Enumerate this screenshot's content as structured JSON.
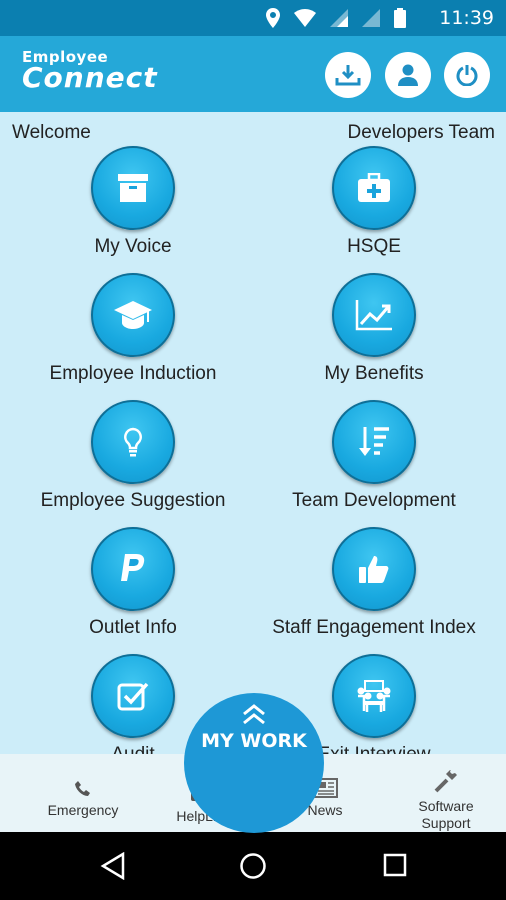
{
  "status_bar": {
    "time": "11:39",
    "icons": [
      "location-icon",
      "wifi-icon",
      "signal-icon",
      "signal-icon",
      "battery-icon"
    ]
  },
  "app_bar": {
    "logo_line1": "Employee",
    "logo_line2": "Connect",
    "buttons": [
      "download-icon",
      "user-icon",
      "power-icon"
    ]
  },
  "header": {
    "welcome": "Welcome",
    "team": "Developers Team"
  },
  "tiles": [
    {
      "label": "My Voice",
      "icon": "archive-box-icon"
    },
    {
      "label": "HSQE",
      "icon": "first-aid-kit-icon"
    },
    {
      "label": "Employee Induction",
      "icon": "graduation-cap-icon"
    },
    {
      "label": "My Benefits",
      "icon": "trending-chart-icon"
    },
    {
      "label": "Employee Suggestion",
      "icon": "lightbulb-icon"
    },
    {
      "label": "Team Development",
      "icon": "sort-descending-icon"
    },
    {
      "label": "Outlet Info",
      "icon": "paypal-icon"
    },
    {
      "label": "Staff Engagement Index",
      "icon": "thumbs-up-icon"
    },
    {
      "label": "Audit",
      "icon": "checkbox-icon"
    },
    {
      "label": "Exit Interview",
      "icon": "meeting-people-icon"
    }
  ],
  "my_work": {
    "label": "MY WORK",
    "icon": "double-chevron-up-icon"
  },
  "bottom_nav": [
    {
      "label": "Emergency",
      "icon": "phone-icon"
    },
    {
      "label": "HelpLine",
      "icon": "headset-icon"
    },
    {
      "label": "News",
      "icon": "newspaper-icon"
    },
    {
      "label": "Software Support",
      "icon": "wrench-icon"
    }
  ],
  "colors": {
    "status_bar": "#0b7fb0",
    "app_bar": "#25a8d8",
    "background": "#cdedf9",
    "tile_circle": "#19a9e0",
    "my_work": "#1e98d6"
  }
}
